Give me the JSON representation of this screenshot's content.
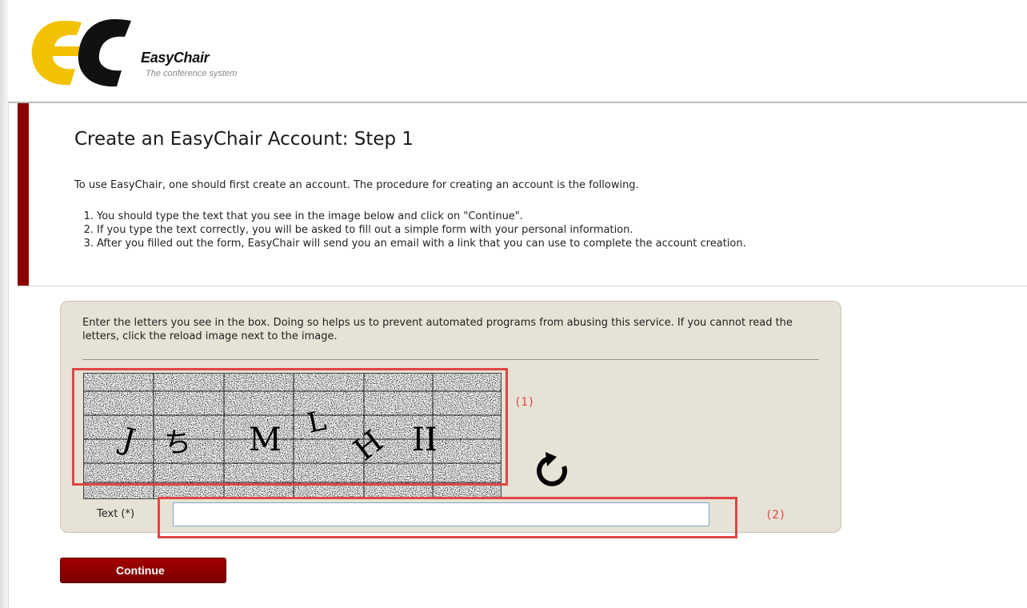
{
  "logo": {
    "brand": "EasyChair",
    "tagline": "The conference system"
  },
  "page": {
    "title": "Create an EasyChair Account: Step 1",
    "intro": "To use EasyChair, one should first create an account. The procedure for creating an account is the following.",
    "steps": [
      {
        "num": "1.",
        "text": "You should type the text that you see in the image below and click on \"Continue\"."
      },
      {
        "num": "2.",
        "text": "If you type the text correctly, you will be asked to fill out a simple form with your personal information."
      },
      {
        "num": "3.",
        "text": "After you filled out the form, EasyChair will send you an email with a link that you can use to complete the account creation."
      }
    ]
  },
  "captcha": {
    "instructions": "Enter the letters you see in the box. Doing so helps us to prevent automated programs from abusing this service. If you cannot read the letters, click the reload image next to the image.",
    "glyphs": [
      "J",
      "ち",
      "M",
      "L",
      "H",
      "II"
    ],
    "reload_icon": "reload-icon",
    "text_label": "Text (*)",
    "text_value": ""
  },
  "annotations": {
    "label_1": "(1)",
    "label_2": "(2)",
    "color": "#e04545"
  },
  "actions": {
    "continue_label": "Continue"
  },
  "colors": {
    "accent": "#8b0000",
    "panel": "#e6e2d5"
  }
}
